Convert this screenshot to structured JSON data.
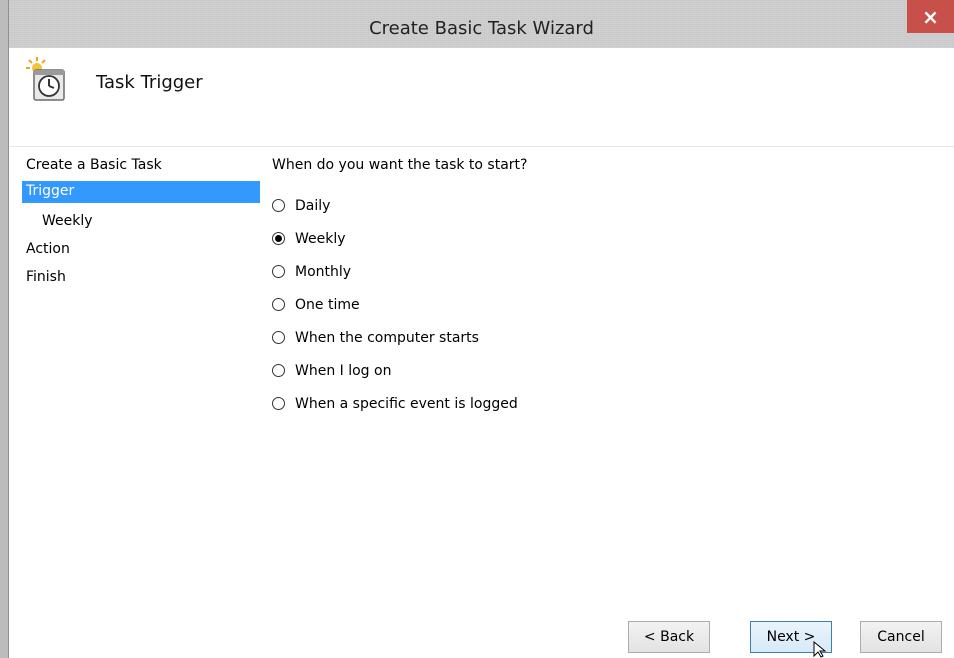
{
  "window": {
    "title": "Create Basic Task Wizard",
    "close_glyph": "×"
  },
  "header": {
    "title": "Task Trigger",
    "icon": "clock-icon"
  },
  "steps": [
    {
      "label": "Create a Basic Task"
    },
    {
      "label": "Trigger"
    },
    {
      "label": "Weekly"
    },
    {
      "label": "Action"
    },
    {
      "label": "Finish"
    }
  ],
  "question": "When do you want the task to start?",
  "options": [
    {
      "label": "Daily",
      "selected": false
    },
    {
      "label": "Weekly",
      "selected": true
    },
    {
      "label": "Monthly",
      "selected": false
    },
    {
      "label": "One time",
      "selected": false
    },
    {
      "label": "When the computer starts",
      "selected": false
    },
    {
      "label": "When I log on",
      "selected": false
    },
    {
      "label": "When a specific event is logged",
      "selected": false
    }
  ],
  "buttons": {
    "back": "< Back",
    "next": "Next >",
    "cancel": "Cancel"
  },
  "colors": {
    "selection": "#3399ff",
    "close": "#c7514a"
  }
}
